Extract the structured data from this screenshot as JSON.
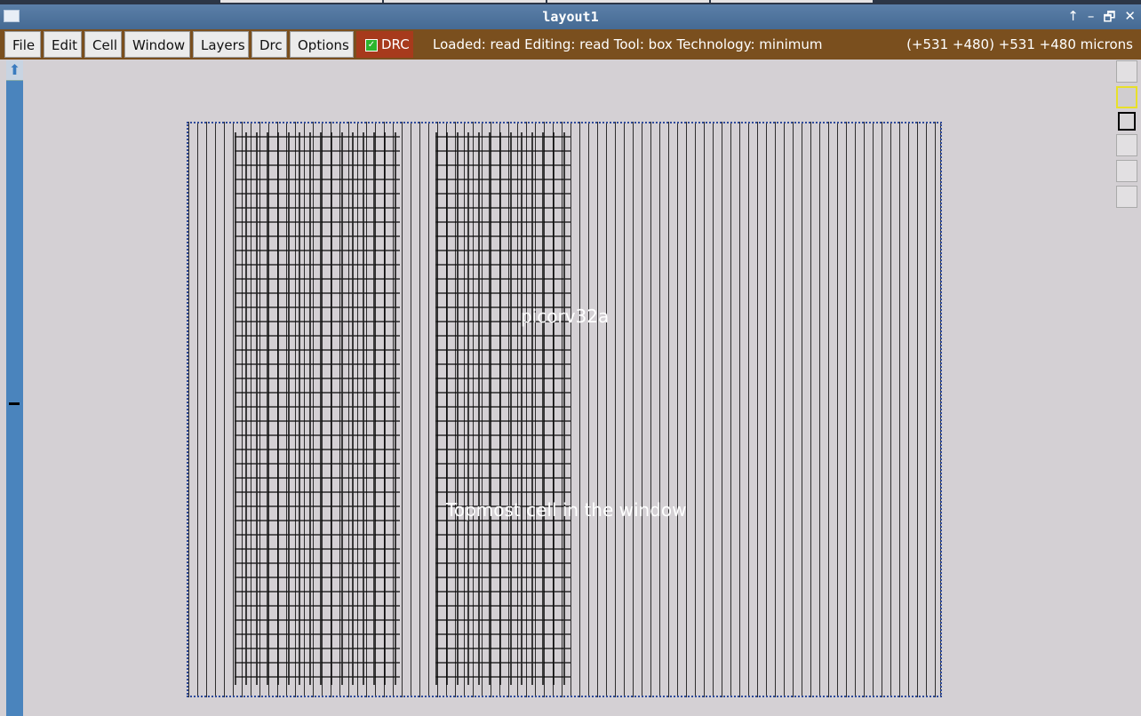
{
  "window": {
    "title": "layout1",
    "controls": [
      "↑",
      "–",
      "🗗",
      "✕"
    ]
  },
  "menu": {
    "items": [
      "File",
      "Edit",
      "Cell",
      "Window",
      "Layers",
      "Drc",
      "Options"
    ],
    "drc_label": "DRC",
    "status": "Loaded: read Editing: read Tool: box  Technology: minimum",
    "coords": "(+531 +480) +531 +480 microns"
  },
  "canvas": {
    "cell_name": "picorv32a",
    "caption": "Topmost cell in the window"
  },
  "colors": {
    "title_bar": "#4d729c",
    "menu_bar": "#7a4f1e",
    "drc_button": "#a73a1c",
    "scrollbar": "#4a84bd",
    "canvas_bg": "#d4d0d4"
  },
  "icons": {
    "scroll_up": "up-arrow-icon",
    "window_icon": "window-icon"
  }
}
